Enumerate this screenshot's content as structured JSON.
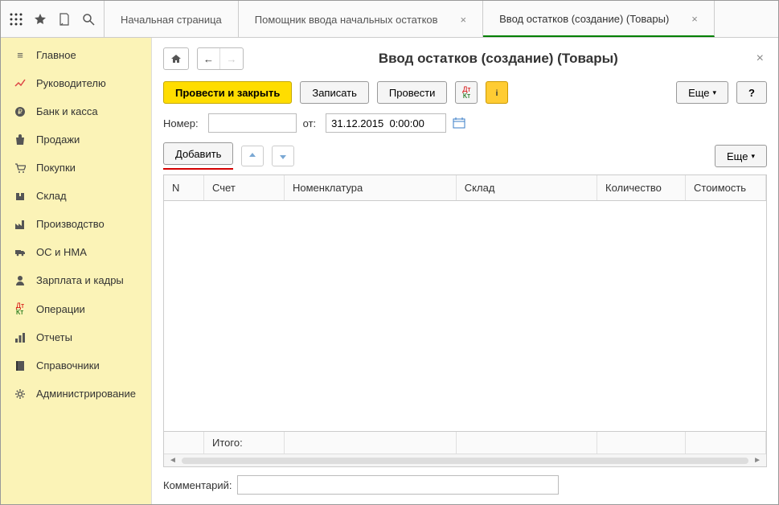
{
  "tabs": {
    "home": "Начальная страница",
    "helper": "Помощник ввода начальных остатков",
    "entry": "Ввод остатков (создание) (Товары)"
  },
  "sidebar": {
    "items": [
      {
        "label": "Главное"
      },
      {
        "label": "Руководителю"
      },
      {
        "label": "Банк и касса"
      },
      {
        "label": "Продажи"
      },
      {
        "label": "Покупки"
      },
      {
        "label": "Склад"
      },
      {
        "label": "Производство"
      },
      {
        "label": "ОС и НМА"
      },
      {
        "label": "Зарплата и кадры"
      },
      {
        "label": "Операции"
      },
      {
        "label": "Отчеты"
      },
      {
        "label": "Справочники"
      },
      {
        "label": "Администрирование"
      }
    ]
  },
  "page": {
    "title": "Ввод остатков (создание) (Товары)",
    "close": "×"
  },
  "buttons": {
    "post_close": "Провести и закрыть",
    "write": "Записать",
    "post": "Провести",
    "more": "Еще",
    "help": "?",
    "add": "Добавить"
  },
  "form": {
    "number_label": "Номер:",
    "number_value": "",
    "from_label": "от:",
    "date_value": "31.12.2015  0:00:00",
    "comment_label": "Комментарий:",
    "comment_value": ""
  },
  "table": {
    "headers": {
      "n": "N",
      "account": "Счет",
      "nomenclature": "Номенклатура",
      "warehouse": "Склад",
      "quantity": "Количество",
      "cost": "Стоимость"
    },
    "footer": {
      "total": "Итого:"
    }
  }
}
